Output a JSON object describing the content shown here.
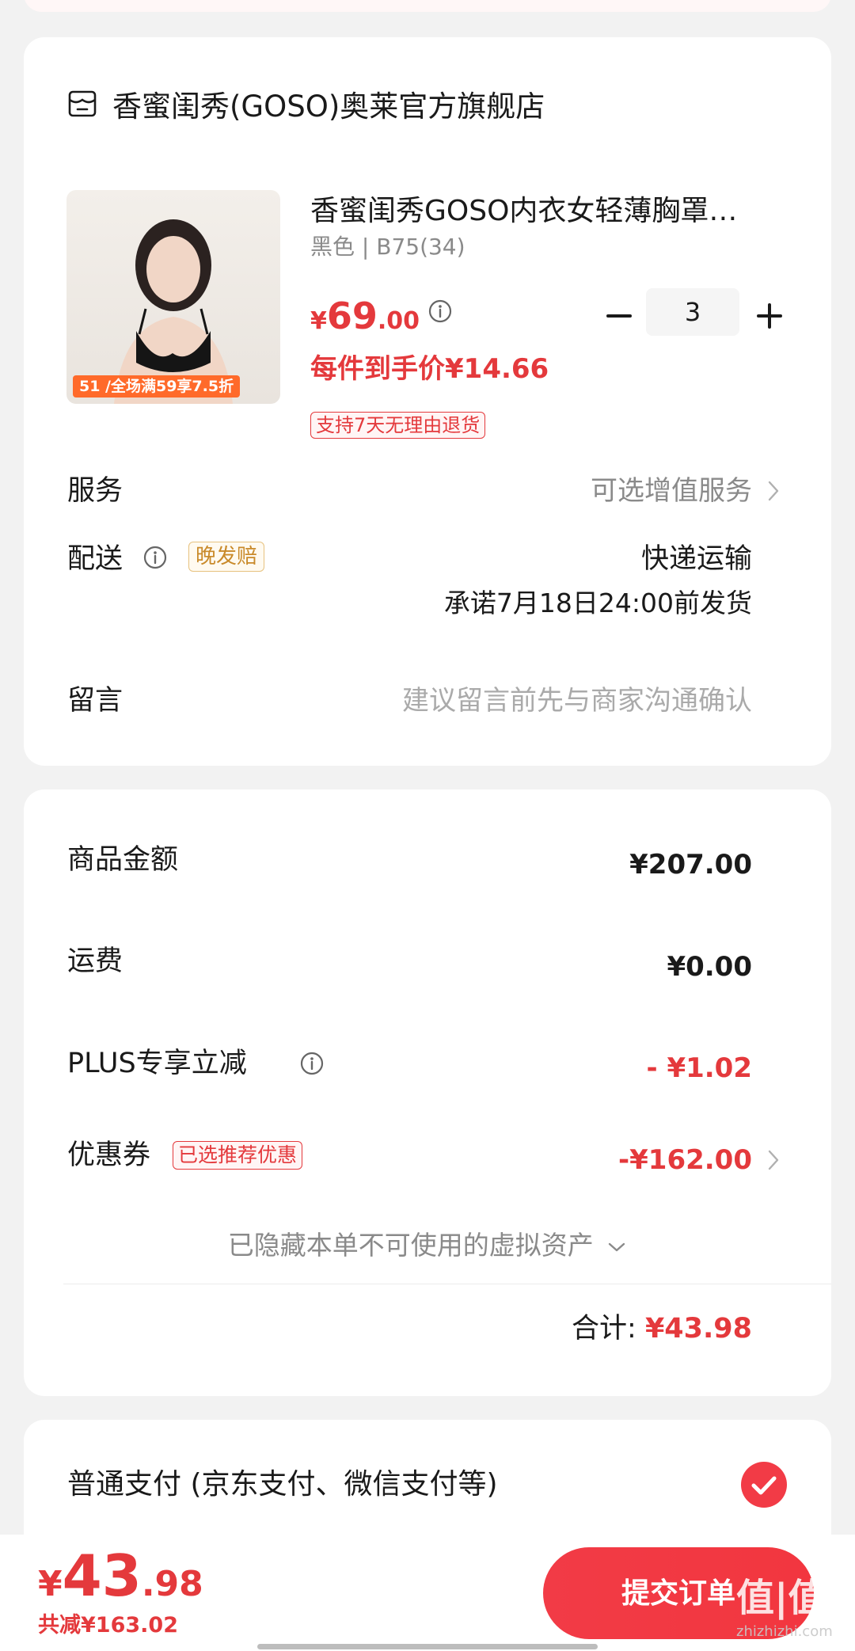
{
  "store": {
    "name": "香蜜闺秀(GOSO)奥莱官方旗舰店"
  },
  "product": {
    "title": "香蜜闺秀GOSO内衣女轻薄胸罩…",
    "spec": "黑色 | B75(34)",
    "price_symbol": "¥",
    "price_int": "69",
    "price_dec": ".00",
    "quantity": "3",
    "unit_price": "每件到手价¥14.66",
    "return_policy": "支持7天无理由退货",
    "promo_badge": "51 /全场满59享7.5折"
  },
  "service": {
    "label": "服务",
    "value": "可选增值服务"
  },
  "delivery": {
    "label": "配送",
    "tag": "晚发赔",
    "method": "快递运输",
    "promise": "承诺7月18日24:00前发货"
  },
  "message": {
    "label": "留言",
    "placeholder": "建议留言前先与商家沟通确认"
  },
  "summary": {
    "goods_label": "商品金额",
    "goods_value": "¥207.00",
    "shipping_label": "运费",
    "shipping_value": "¥0.00",
    "plus_label": "PLUS专享立减",
    "plus_value": "- ¥1.02",
    "coupon_label": "优惠券",
    "coupon_tag": "已选推荐优惠",
    "coupon_value": "-¥162.00",
    "hidden_assets": "已隐藏本单不可使用的虚拟资产",
    "total_label": "合计:",
    "total_value": "¥43.98"
  },
  "payment": {
    "label": "普通支付 (京东支付、微信支付等)"
  },
  "bottom": {
    "price_symbol": "¥",
    "price_int": "43",
    "price_dec": ".98",
    "savings": "共减¥163.02",
    "submit": "提交订单",
    "watermark": "值|值|值",
    "watermark_sub": "zhizhizhi.com"
  },
  "colors": {
    "accent": "#e4393c",
    "background": "#f2f2f2"
  }
}
